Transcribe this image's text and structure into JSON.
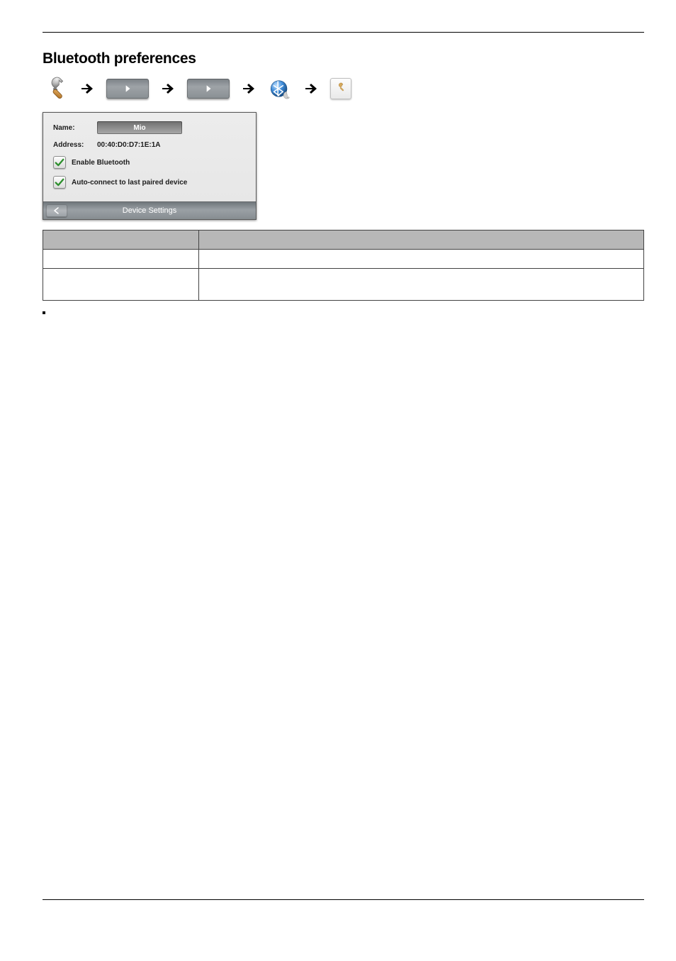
{
  "title": "Bluetooth preferences",
  "breadcrumb": {
    "step1_icon": "wrench-icon",
    "step2_icon": "chevron-panel",
    "step3_icon": "chevron-panel",
    "step4_icon": "bluetooth-orb",
    "step5_icon": "settings-square"
  },
  "device_panel": {
    "name_label": "Name:",
    "name_value": "Mio",
    "address_label": "Address:",
    "address_value": "00:40:D0:D7:1E:1A",
    "enable_label": "Enable Bluetooth",
    "enable_checked": true,
    "autoconnect_label": "Auto-connect to last paired device",
    "autoconnect_checked": true,
    "bar_label": "Device Settings"
  },
  "table": {
    "rows": [
      {
        "c1": "",
        "c2": ""
      },
      {
        "c1": "",
        "c2": ""
      },
      {
        "c1": "",
        "c2": ""
      }
    ]
  }
}
